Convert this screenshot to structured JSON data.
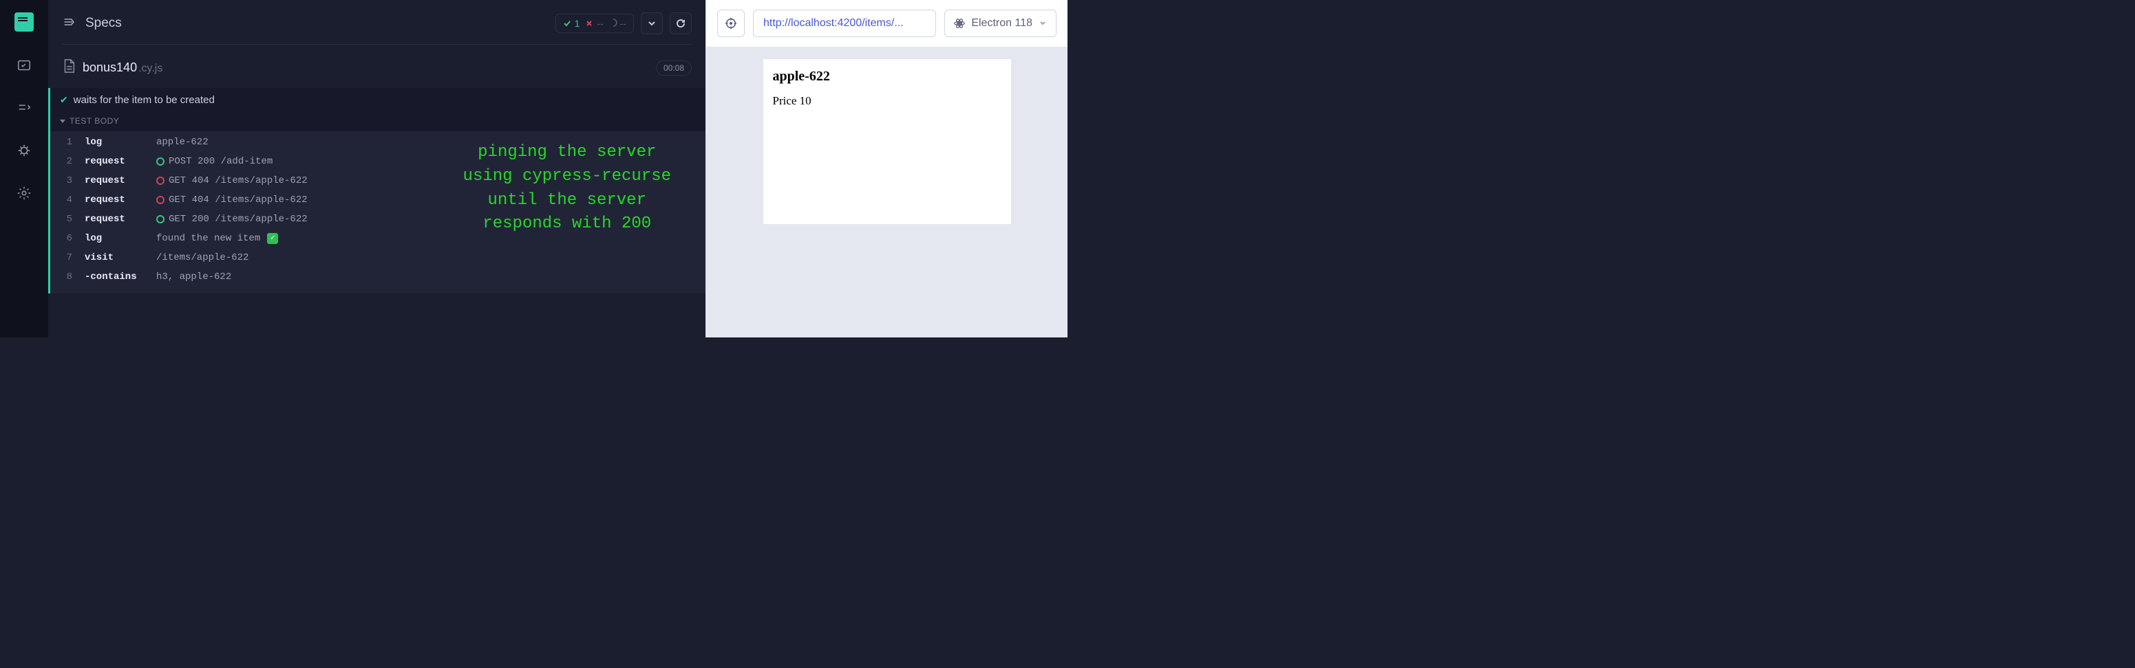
{
  "header": {
    "specs_title": "Specs",
    "pass_count": "1",
    "fail_count": "--",
    "pending_count": "--"
  },
  "spec": {
    "name": "bonus140",
    "ext": ".cy.js",
    "timer": "00:08"
  },
  "test": {
    "title": "waits for the item to be created",
    "section_label": "TEST BODY"
  },
  "commands": [
    {
      "line": "1",
      "cmd": "log",
      "status": "",
      "text": "apple-622"
    },
    {
      "line": "2",
      "cmd": "request",
      "status": "green",
      "text": "POST 200 /add-item"
    },
    {
      "line": "3",
      "cmd": "request",
      "status": "red",
      "text": "GET 404 /items/apple-622"
    },
    {
      "line": "4",
      "cmd": "request",
      "status": "red",
      "text": "GET 404 /items/apple-622"
    },
    {
      "line": "5",
      "cmd": "request",
      "status": "green",
      "text": "GET 200 /items/apple-622"
    },
    {
      "line": "6",
      "cmd": "log",
      "status": "",
      "text": "found the new item",
      "badge": true
    },
    {
      "line": "7",
      "cmd": "visit",
      "status": "",
      "text": "/items/apple-622"
    },
    {
      "line": "8",
      "cmd": "-contains",
      "status": "",
      "text": "h3, apple-622"
    }
  ],
  "annotation": "pinging the server\nusing cypress-recurse\nuntil the server\nresponds with 200",
  "preview": {
    "url": "http://localhost:4200/items/...",
    "browser": "Electron 118",
    "heading": "apple-622",
    "price": "Price 10"
  }
}
